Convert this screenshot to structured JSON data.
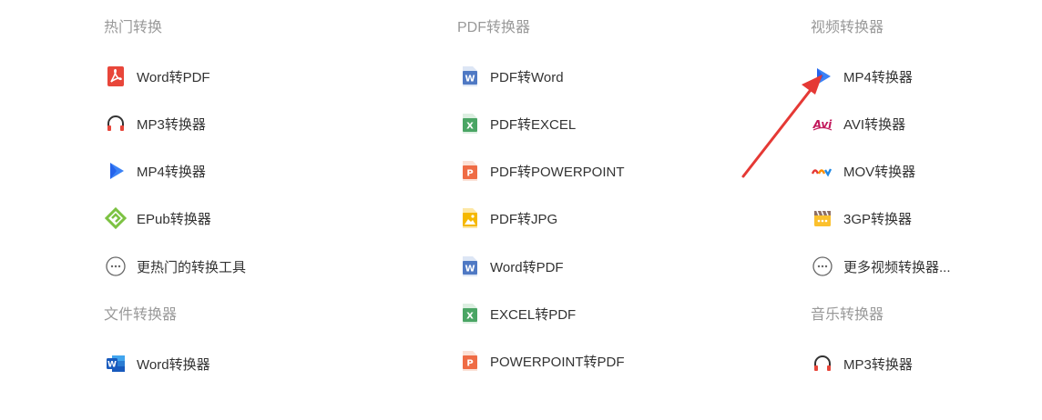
{
  "columns": [
    {
      "heading": "热门转换",
      "items": [
        {
          "label": "Word转PDF",
          "icon": "pdf-acrobat-icon"
        },
        {
          "label": "MP3转换器",
          "icon": "headphones-icon"
        },
        {
          "label": "MP4转换器",
          "icon": "play-icon"
        },
        {
          "label": "EPub转换器",
          "icon": "epub-icon"
        },
        {
          "label": "更热门的转换工具",
          "icon": "more-icon"
        }
      ],
      "heading2": "文件转换器",
      "items2": [
        {
          "label": "Word转换器",
          "icon": "word-icon"
        }
      ]
    },
    {
      "heading": "PDF转换器",
      "items": [
        {
          "label": "PDF转Word",
          "icon": "word-doc-icon"
        },
        {
          "label": "PDF转EXCEL",
          "icon": "excel-doc-icon"
        },
        {
          "label": "PDF转POWERPOINT",
          "icon": "powerpoint-doc-icon"
        },
        {
          "label": "PDF转JPG",
          "icon": "jpg-doc-icon"
        },
        {
          "label": "Word转PDF",
          "icon": "word-doc-icon"
        },
        {
          "label": "EXCEL转PDF",
          "icon": "excel-doc-icon"
        },
        {
          "label": "POWERPOINT转PDF",
          "icon": "powerpoint-doc-icon"
        }
      ]
    },
    {
      "heading": "视频转换器",
      "items": [
        {
          "label": "MP4转换器",
          "icon": "play-icon"
        },
        {
          "label": "AVI转换器",
          "icon": "avi-icon"
        },
        {
          "label": "MOV转换器",
          "icon": "mov-icon"
        },
        {
          "label": "3GP转换器",
          "icon": "clapperboard-icon"
        },
        {
          "label": "更多视频转换器...",
          "icon": "more-icon"
        }
      ],
      "heading2": "音乐转换器",
      "items2": [
        {
          "label": "MP3转换器",
          "icon": "headphones-icon"
        }
      ]
    }
  ],
  "colors": {
    "heading": "#999999",
    "text": "#333333",
    "arrow": "#e53935"
  }
}
